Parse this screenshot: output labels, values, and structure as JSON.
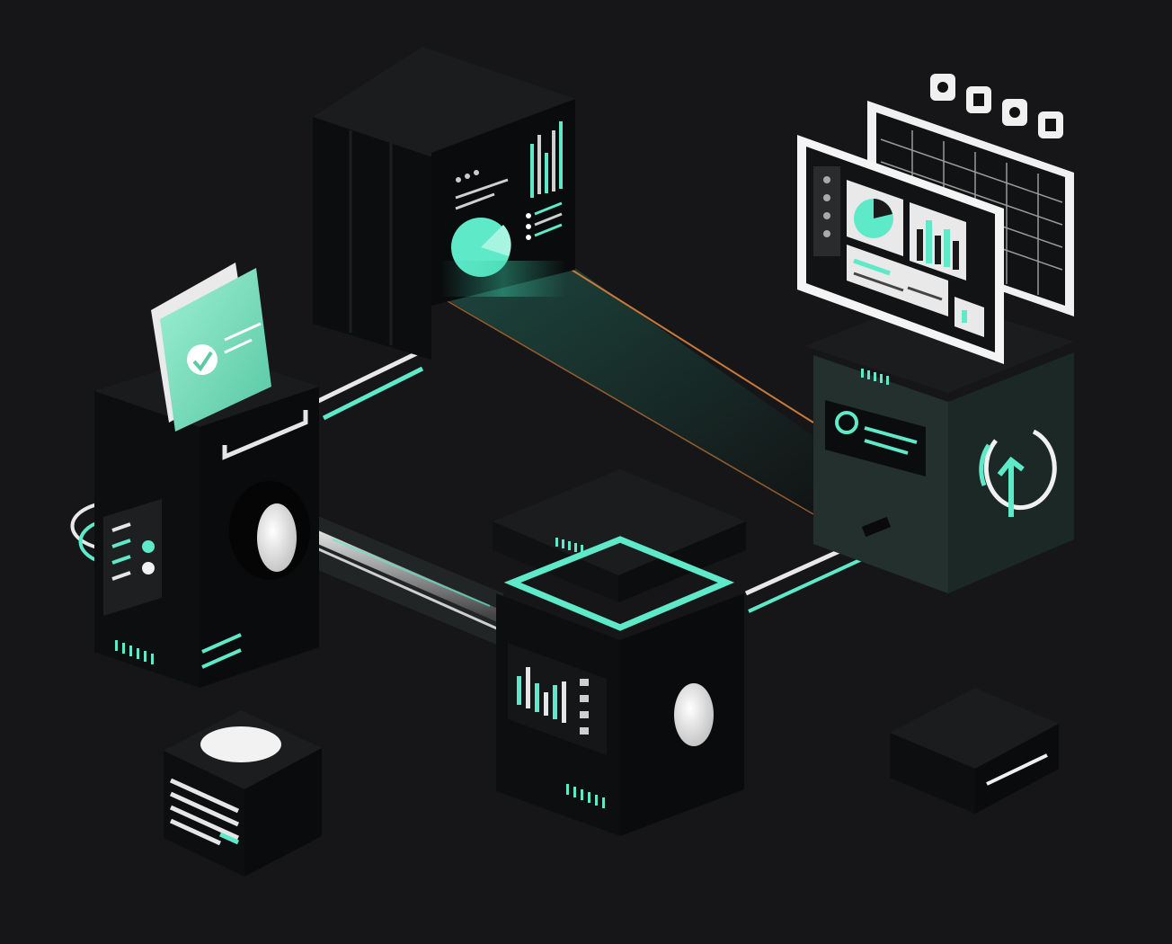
{
  "palette": {
    "background": "#161618",
    "accent": "#5ee9c8",
    "accent_soft": "#7be3bf",
    "accent_dim": "#1e5e50",
    "panel_white": "#f2f2f2",
    "orange_glow": "#d07a3a",
    "teal_block": "#23302e",
    "block_dark": "#0c0d0e"
  },
  "icons": {
    "check": "check-icon",
    "power_arrow": "power-arrow-icon",
    "app_tiles": [
      "app-tile-icon",
      "app-tile-icon",
      "app-tile-icon",
      "app-tile-icon"
    ]
  }
}
